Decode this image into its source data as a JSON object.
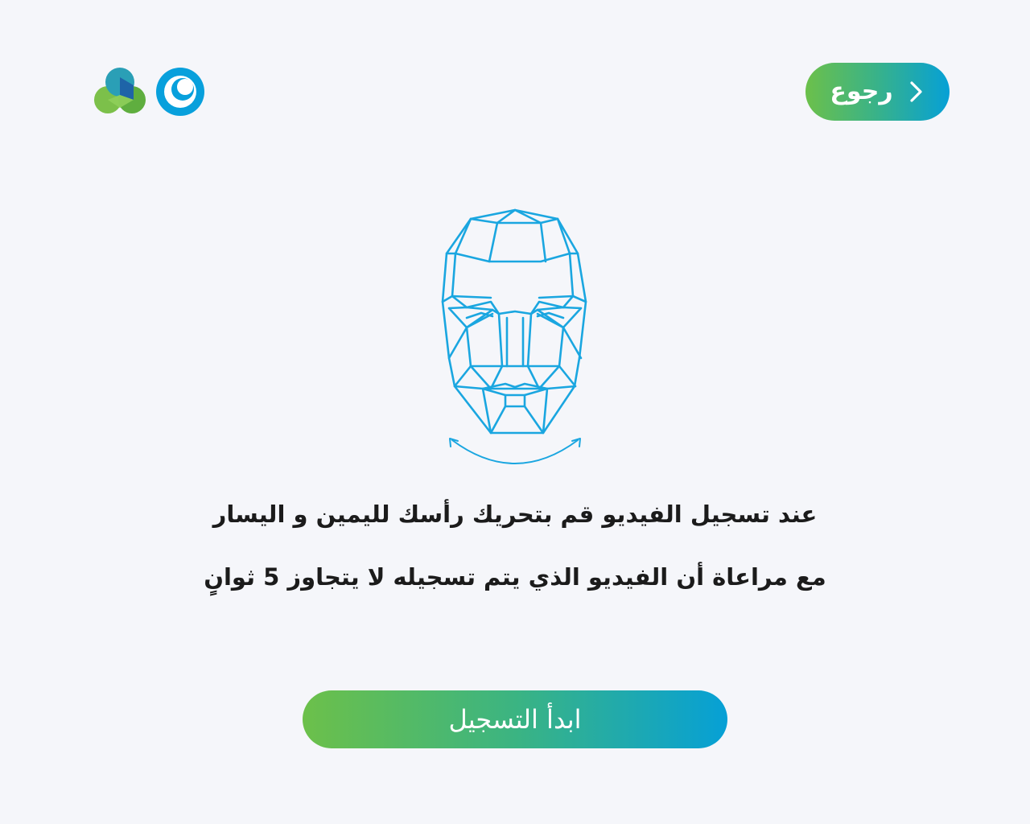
{
  "header": {
    "back_label": "رجوع",
    "back_icon": "chevron-right-icon",
    "logos": [
      "brand-logo-cluster",
      "brand-logo-ring"
    ]
  },
  "illustration": {
    "icon": "face-mesh-icon",
    "rotation_hint_icon": "head-rotate-arrows-icon"
  },
  "instructions": {
    "line1": "عند تسجيل الفيديو قم بتحريك رأسك لليمين و اليسار",
    "line2": "مع مراعاة أن الفيديو الذي يتم تسجيله لا يتجاوز 5 ثوانٍ"
  },
  "actions": {
    "start_label": "ابدأ التسجيل"
  },
  "colors": {
    "background": "#f5f6fa",
    "gradient_start": "#6cc04a",
    "gradient_end": "#06a0d6",
    "face_stroke": "#1aa6e0",
    "text": "#1b1b1b"
  }
}
